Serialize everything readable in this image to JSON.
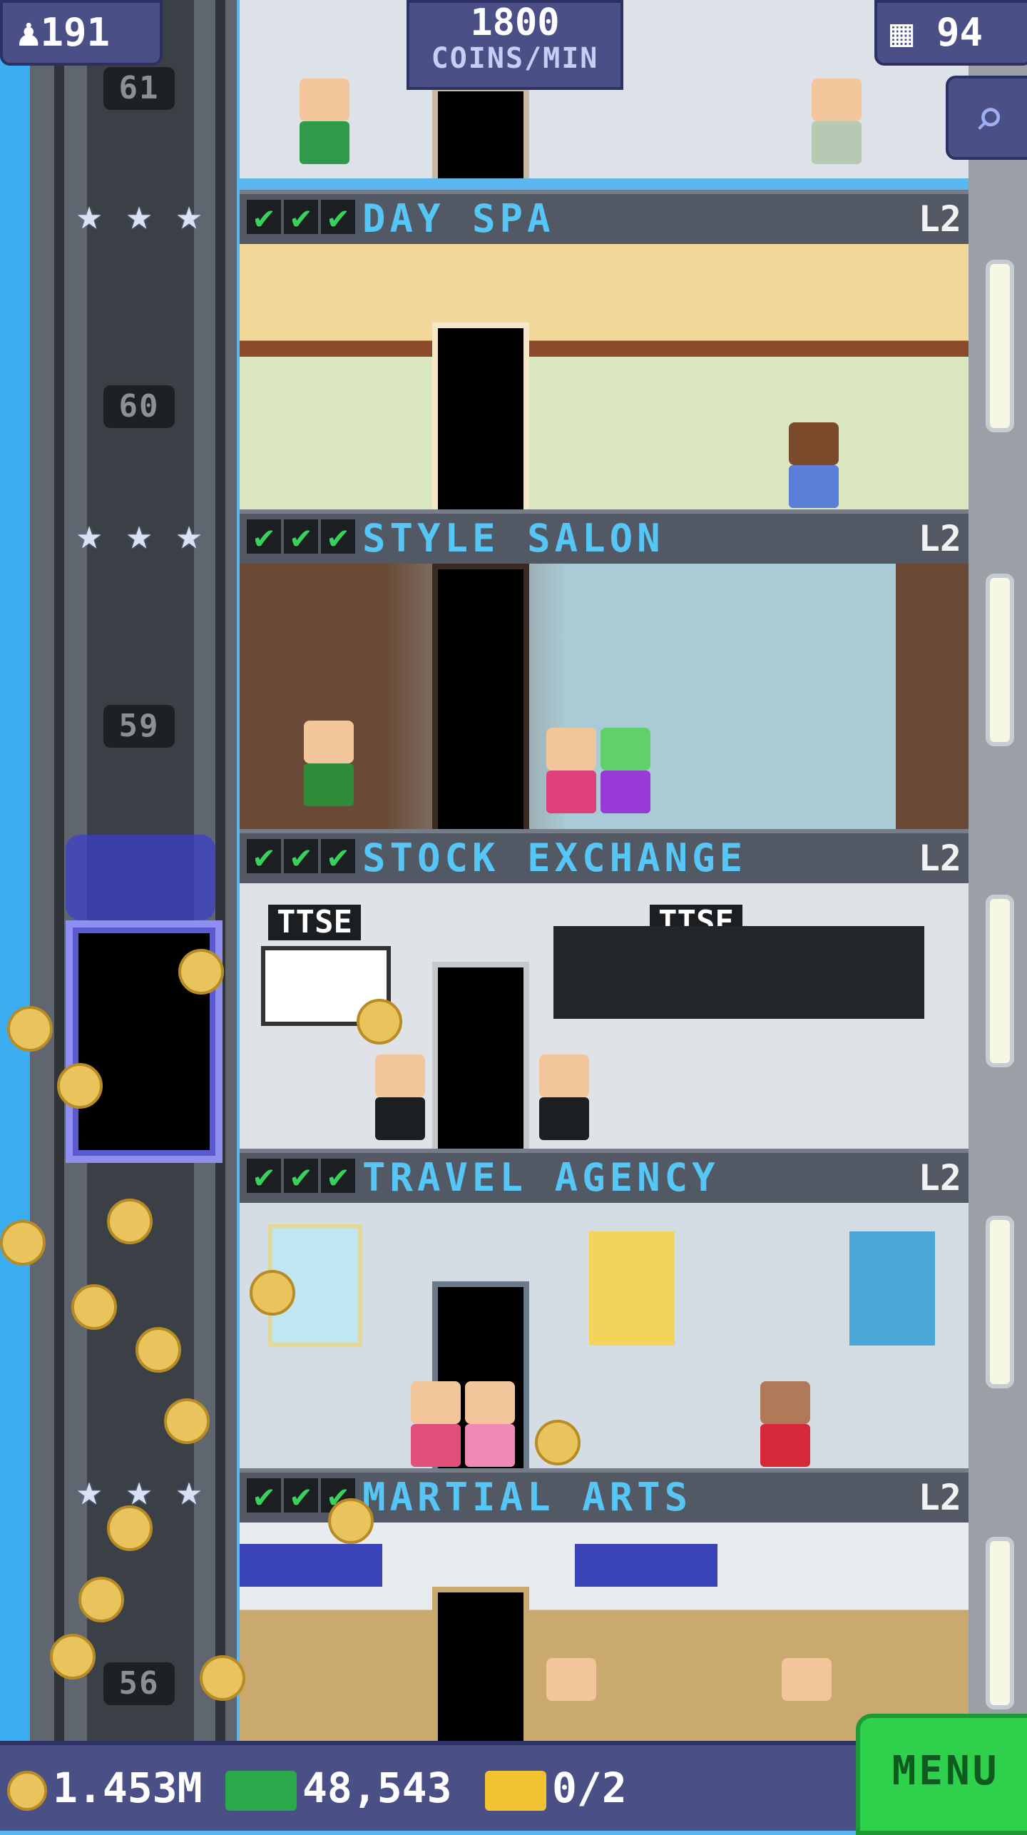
{
  "header": {
    "population": "191",
    "coins_per_min_value": "1800",
    "coins_per_min_label": "COINS/MIN",
    "floors_count": "94"
  },
  "elevator": {
    "floor_numbers": [
      "61",
      "60",
      "59",
      "56"
    ]
  },
  "floors": [
    {
      "name": "DAY SPA",
      "level": "L2",
      "checks": 3
    },
    {
      "name": "STYLE SALON",
      "level": "L2",
      "checks": 3
    },
    {
      "name": "STOCK EXCHANGE",
      "level": "L2",
      "checks": 3
    },
    {
      "name": "TRAVEL AGENCY",
      "level": "L2",
      "checks": 3
    },
    {
      "name": "MARTIAL ARTS",
      "level": "L2",
      "checks": 3
    }
  ],
  "signs": {
    "stock_left": "TTSE",
    "stock_right": "TTSE"
  },
  "footer": {
    "coins": "1.453M",
    "bux": "48,543",
    "tickets": "0/2",
    "menu_label": "MENU"
  },
  "colors": {
    "floor_name": "#56c6f6",
    "menu_green": "#2fd04c",
    "bar_purple": "#4a4f86"
  },
  "icons": {
    "population": "person-icon",
    "floors": "building-icon",
    "search": "magnifier-icon",
    "coins": "coin-icon",
    "bux": "bux-icon",
    "tickets": "ticket-icon"
  }
}
